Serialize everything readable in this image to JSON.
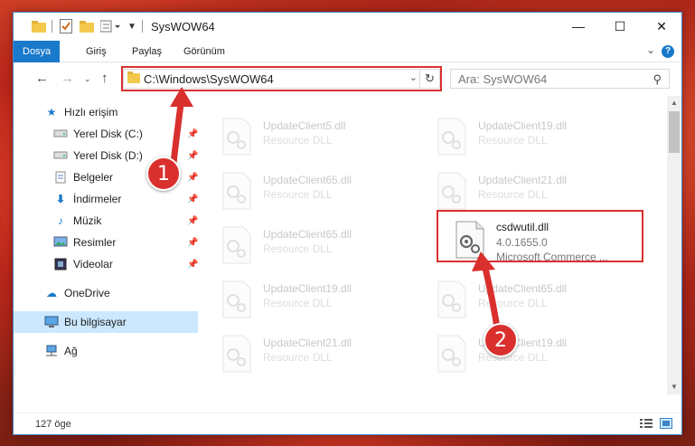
{
  "window": {
    "title": "SysWOW64",
    "controls": {
      "minimize": "—",
      "maximize": "☐",
      "close": "✕"
    }
  },
  "ribbon": {
    "tabs": [
      {
        "label": "Dosya",
        "active": true
      },
      {
        "label": "Giriş"
      },
      {
        "label": "Paylaş"
      },
      {
        "label": "Görünüm"
      }
    ],
    "help": "?"
  },
  "nav": {
    "address": "C:\\Windows\\SysWOW64",
    "search_placeholder": "Ara: SysWOW64"
  },
  "sidebar": {
    "items": [
      {
        "label": "Hızlı erişim",
        "icon": "star-icon",
        "pinned": false
      },
      {
        "label": "Yerel Disk (C:)",
        "icon": "drive-icon",
        "pinned": true
      },
      {
        "label": "Yerel Disk (D:)",
        "icon": "drive-icon",
        "pinned": true
      },
      {
        "label": "Belgeler",
        "icon": "documents-icon",
        "pinned": true
      },
      {
        "label": "İndirmeler",
        "icon": "downloads-icon",
        "pinned": true
      },
      {
        "label": "Müzik",
        "icon": "music-icon",
        "pinned": true
      },
      {
        "label": "Resimler",
        "icon": "pictures-icon",
        "pinned": true
      },
      {
        "label": "Videolar",
        "icon": "videos-icon",
        "pinned": true
      },
      {
        "label": "OneDrive",
        "icon": "cloud-icon",
        "pinned": false
      },
      {
        "label": "Bu bilgisayar",
        "icon": "computer-icon",
        "pinned": false,
        "selected": true
      },
      {
        "label": "Ağ",
        "icon": "network-icon",
        "pinned": false
      }
    ]
  },
  "files": {
    "left": [
      {
        "name": "UpdateClient5.dll",
        "type": "Resource DLL"
      },
      {
        "name": "UpdateClient65.dll",
        "type": "Resource DLL"
      },
      {
        "name": "UpdateClient65.dll",
        "type": "Resource DLL"
      },
      {
        "name": "UpdateClient19.dll",
        "type": "Resource DLL"
      },
      {
        "name": "UpdateClient21.dll",
        "type": "Resource DLL"
      }
    ],
    "right": [
      {
        "name": "UpdateClient19.dll",
        "type": "Resource DLL"
      },
      {
        "name": "UpdateClient21.dll",
        "type": "Resource DLL"
      },
      {
        "name": "UpdateClient65.dll",
        "type": "Resource DLL"
      },
      {
        "name": "UpdateClient19.dll",
        "type": "Resource DLL"
      }
    ],
    "highlighted": {
      "name": "csdwutil.dll",
      "version": "4.0.1655.0",
      "description": "Microsoft Commerce ..."
    }
  },
  "status": {
    "item_count": "127 öge"
  },
  "callouts": {
    "first": "1",
    "second": "2"
  },
  "colors": {
    "accent": "#1979ca",
    "highlight": "#d9302e",
    "selected": "#cce8ff"
  }
}
